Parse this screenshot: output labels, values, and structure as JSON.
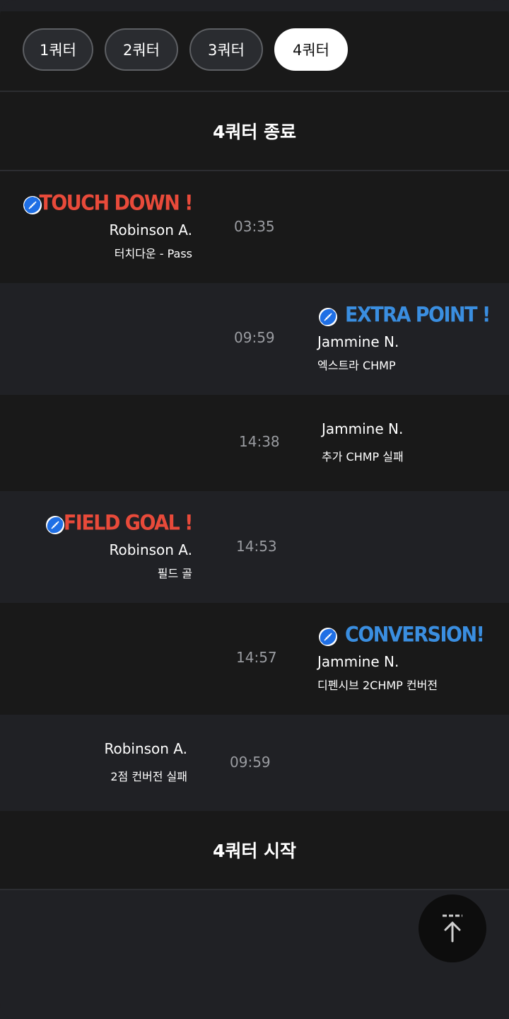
{
  "quarter_tabs": [
    {
      "label": "1쿼터"
    },
    {
      "label": "2쿼터"
    },
    {
      "label": "3쿼터"
    },
    {
      "label": "4쿼터"
    }
  ],
  "active_tab": "4쿼터",
  "header_banner": "4쿼터 종료",
  "footer_banner": "4쿼터 시작",
  "events": [
    {
      "side": "left",
      "headline": "TOUCH DOWN !",
      "headline_color": "#e84a3a",
      "player": "Robinson A.",
      "detail": "터치다운 - Pass",
      "time": "03:35"
    },
    {
      "side": "right",
      "headline": "EXTRA POINT !",
      "headline_color": "#3a8ee0",
      "player": "Jammine N.",
      "detail": "엑스트라 CHMP",
      "time": "09:59"
    },
    {
      "side": "right",
      "headline": "",
      "player": "Jammine N.",
      "detail": "추가 CHMP 실패",
      "time": "14:38"
    },
    {
      "side": "left",
      "headline": "FIELD GOAL !",
      "headline_color": "#e84a3a",
      "player": "Robinson A.",
      "detail": "필드 골",
      "time": "14:53"
    },
    {
      "side": "right",
      "headline": "CONVERSION!",
      "headline_color": "#3a8ee0",
      "player": "Jammine N.",
      "detail": "디펜시브 2CHMP 컨버전",
      "time": "14:57"
    },
    {
      "side": "left",
      "headline": "",
      "player": "Robinson A.",
      "detail": "2점 컨버전 실패",
      "time": "09:59"
    }
  ],
  "icons": {
    "ball": "football-icon",
    "scroll_top": "arrow-up-to-top-icon"
  },
  "colors": {
    "home_team": "#e84a3a",
    "away_team": "#3a8ee0",
    "ball_blue": "#1f6fe5"
  }
}
